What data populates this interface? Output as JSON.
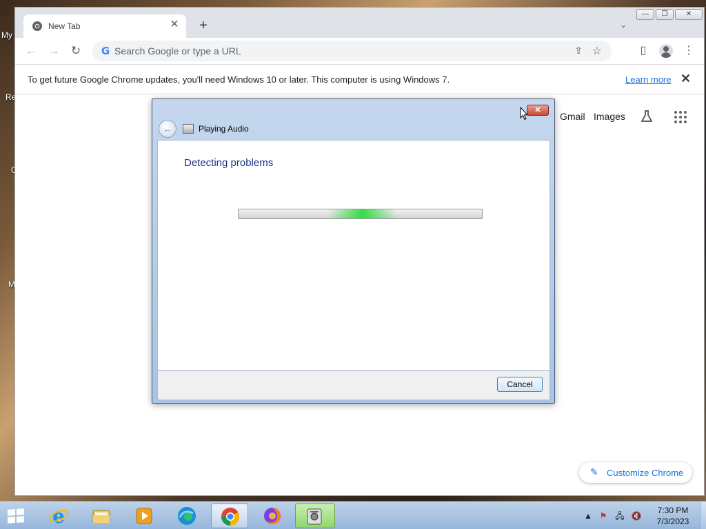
{
  "desktop": {
    "labels": [
      "My",
      "Re",
      "C",
      "M"
    ]
  },
  "browser": {
    "tab": {
      "title": "New Tab"
    },
    "omnibox": {
      "placeholder": "Search Google or type a URL"
    },
    "infobar": {
      "message": "To get future Google Chrome updates, you'll need Windows 10 or later. This computer is using Windows 7.",
      "link": "Learn more"
    },
    "ntp": {
      "gmail": "Gmail",
      "images": "Images",
      "customize": "Customize Chrome"
    }
  },
  "dialog": {
    "title": "Playing Audio",
    "heading": "Detecting problems",
    "progress_state": "indeterminate",
    "cancel": "Cancel"
  },
  "taskbar": {
    "apps": [
      "internet-explorer",
      "file-explorer",
      "media-player",
      "edge",
      "chrome",
      "firefox",
      "troubleshooter"
    ],
    "active_app": "chrome",
    "highlighted_app": "troubleshooter",
    "clock": {
      "time": "7:30 PM",
      "date": "7/3/2023"
    }
  },
  "colors": {
    "accent": "#1a73e8",
    "dialog_heading": "#1e3287",
    "progress_glow": "#28dc3c",
    "taskbar": "#96b6da"
  }
}
